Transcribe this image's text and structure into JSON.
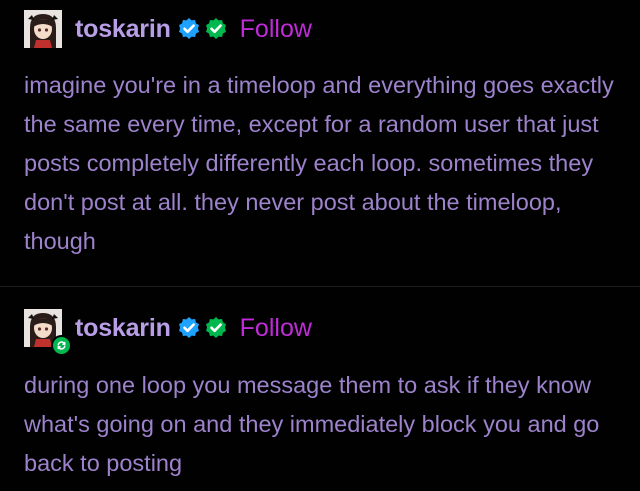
{
  "posts": [
    {
      "username": "toskarin",
      "follow_label": "Follow",
      "body": "imagine you're in a timeloop and everything goes exactly the same every time, except for a random user that just posts completely differently each loop. sometimes they don't post at all. they never post about the timeloop, though",
      "reblogged": false
    },
    {
      "username": "toskarin",
      "follow_label": "Follow",
      "body": "during one loop you message them to ask if they know what's going on and they immediately block you and go back to posting",
      "reblogged": true
    }
  ],
  "colors": {
    "background": "#010101",
    "username": "#b89ee6",
    "follow": "#c02bd8",
    "body_text": "#9d82cc",
    "verified_blue": "#1fa1ff",
    "verified_green": "#00b84d"
  },
  "icons": {
    "verified": "blue-checkmark-badge-icon",
    "verified_secondary": "green-checkmark-badge-icon",
    "reblog": "reblog-icon"
  }
}
